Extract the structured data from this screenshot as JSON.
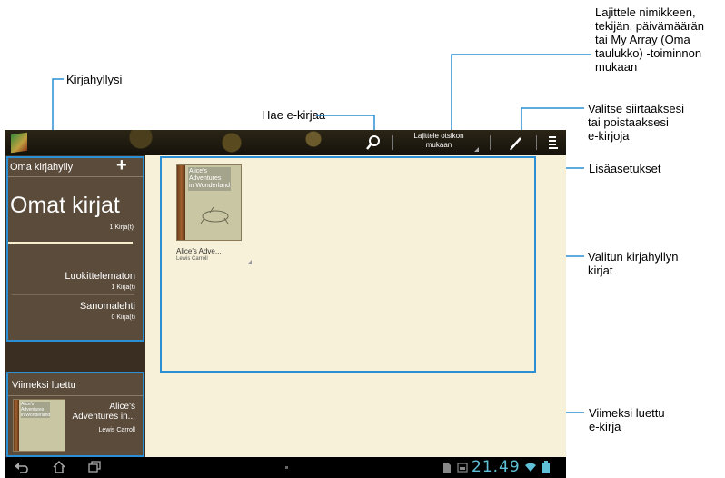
{
  "callouts": {
    "kirjahyllysi": "Kirjahyllysi",
    "hae": "Hae e-kirjaa",
    "lajittele": [
      "Lajittele nimikkeen,",
      "tekijän, päivämäärän",
      "tai My Array (Oma",
      "taulukko) -toiminnon",
      "mukaan"
    ],
    "valitse": [
      "Valitse siirtääksesi",
      "tai poistaaksesi",
      "e-kirjoja"
    ],
    "lisaasetukset": "Lisäasetukset",
    "valitun": [
      "Valitun kirjahyllyn",
      "kirjat"
    ],
    "viimeksi": [
      "Viimeksi luettu",
      "e-kirja"
    ]
  },
  "topbar": {
    "sort_label": [
      "Lajittele otsikon",
      "mukaan"
    ],
    "icons": [
      "app-icon",
      "search-icon",
      "pencil-icon",
      "menu-icon"
    ]
  },
  "sidebar": {
    "shelf_header": "Oma kirjahylly",
    "add_symbol": "+",
    "my_books_title": "Omat kirjat",
    "my_books_count": "1 Kirja(t)",
    "items": [
      {
        "label": "Luokittelematon",
        "count": "1 Kirja(t)"
      },
      {
        "label": "Sanomalehti",
        "count": "0 Kirja(t)"
      }
    ],
    "recent_header": "Viimeksi luettu",
    "recent_book": {
      "title": [
        "Alice's",
        "Adventures in..."
      ],
      "author": "Lewis Carroll",
      "cover": [
        "Alice's",
        "Adventures",
        "in Wonderland"
      ]
    }
  },
  "content": {
    "book": {
      "cover": [
        "Alice's",
        "Adventures",
        "in Wonderland"
      ],
      "title": "Alice's Adve...",
      "author": "Lewis Carroll"
    }
  },
  "statusbar": {
    "time": "21.49"
  },
  "colors": {
    "callout_blue": "#2a8fd4",
    "time_teal": "#5fc0d8"
  }
}
